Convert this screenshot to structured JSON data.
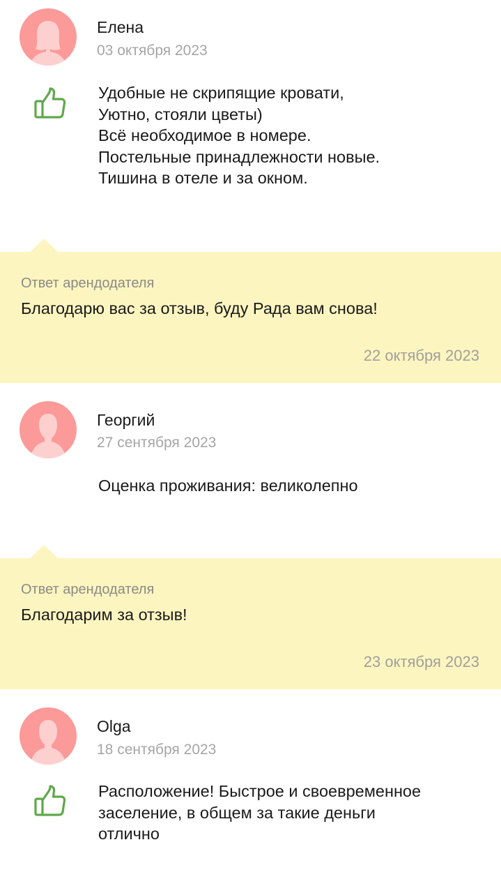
{
  "colors": {
    "avatar_bg": "#fb9a98",
    "like_icon": "#5fa84a",
    "reply_bg": "#fdf5c0",
    "muted_text": "#a5a5a5"
  },
  "reviews": [
    {
      "author": "Елена",
      "date": "03 октября 2023",
      "avatar_icon": "female-avatar-icon",
      "has_like_icon": true,
      "text_lines": [
        "Удобные не скрипящие кровати,",
        "Уютно, стояли цветы)",
        "Всё необходимое в номере.",
        "Постельные принадлежности новые.",
        "Тишина в отеле и за окном."
      ],
      "reply": {
        "label": "Ответ арендодателя",
        "text": "Благодарю вас за отзыв, буду Рада вам снова!",
        "date": "22 октября 2023"
      }
    },
    {
      "author": "Георгий",
      "date": "27 сентября 2023",
      "avatar_icon": "male-avatar-icon",
      "has_like_icon": false,
      "text_lines": [
        "Оценка проживания:  великолепно"
      ],
      "reply": {
        "label": "Ответ арендодателя",
        "text": "Благодарим за отзыв!",
        "date": "23 октября 2023"
      }
    },
    {
      "author": "Olga",
      "date": "18 сентября 2023",
      "avatar_icon": "male-avatar-icon",
      "has_like_icon": true,
      "text_lines": [
        "Расположение! Быстрое и своевременное",
        "заселение, в общем за такие деньги",
        "отлично"
      ]
    }
  ]
}
